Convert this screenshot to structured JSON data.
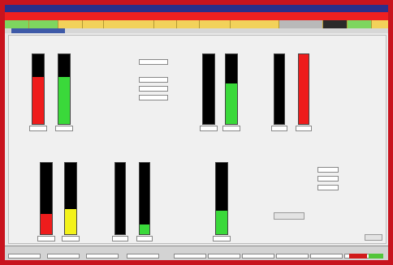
{
  "title": "",
  "alarm_text": "",
  "command_bar": {
    "cells": [
      {
        "label": "",
        "style": "green"
      },
      {
        "label": "",
        "style": "green"
      },
      {
        "label": "",
        "style": ""
      },
      {
        "label": "",
        "style": ""
      },
      {
        "label": "",
        "style": ""
      },
      {
        "label": "",
        "style": ""
      },
      {
        "label": "",
        "style": ""
      },
      {
        "label": "",
        "style": ""
      },
      {
        "label": "",
        "style": ""
      },
      {
        "label": "",
        "style": "gray"
      },
      {
        "label": "",
        "style": "dark"
      },
      {
        "label": "",
        "style": "green"
      }
    ]
  },
  "tab": {
    "label": ""
  },
  "colors": {
    "frame": "#c8141e",
    "alarm": "#ef2020",
    "command": "#f2d25a",
    "fill_red": "#ee1c1c",
    "fill_green": "#3ad93a",
    "fill_yellow": "#f3f21a",
    "bar": "#000000"
  },
  "gauges": {
    "top_left": [
      {
        "name": "",
        "level": 0.67,
        "color": "red",
        "value": ""
      },
      {
        "name": "",
        "level": 0.67,
        "color": "green",
        "value": ""
      }
    ],
    "top_mid": [
      {
        "name": "",
        "level": 0.0,
        "color": "green",
        "value": ""
      },
      {
        "name": "",
        "level": 0.58,
        "color": "green",
        "value": ""
      }
    ],
    "top_right": [
      {
        "name": "",
        "level": 0.0,
        "color": "green",
        "value": ""
      },
      {
        "name": "",
        "level": 1.0,
        "color": "red",
        "value": ""
      }
    ],
    "bot_1": [
      {
        "name": "",
        "level": 0.28,
        "color": "red",
        "value": ""
      },
      {
        "name": "",
        "level": 0.35,
        "color": "yellow",
        "value": ""
      }
    ],
    "bot_2": [
      {
        "name": "",
        "level": 0.0,
        "color": "green",
        "value": ""
      },
      {
        "name": "",
        "level": 0.14,
        "color": "green",
        "value": ""
      }
    ],
    "bot_3": [
      {
        "name": "",
        "level": 0.33,
        "color": "green",
        "value": ""
      }
    ]
  },
  "axis": {
    "top_left": {
      "max": "",
      "mid": "",
      "min": ""
    },
    "top_mid": {
      "max": "",
      "mid": "",
      "min": ""
    },
    "top_right": {
      "max": "",
      "mid": "",
      "min": ""
    },
    "bot": {
      "max": "",
      "mid": "",
      "min": ""
    }
  },
  "fields_top": [
    {
      "label": "",
      "value": "",
      "boxed": true
    },
    {
      "label": "",
      "value": "",
      "boxed": false
    },
    {
      "label": "",
      "value": "",
      "boxed": true
    },
    {
      "label": "",
      "value": "",
      "boxed": true
    },
    {
      "label": "",
      "value": "",
      "boxed": true
    },
    {
      "label": "",
      "value": "",
      "boxed": false
    },
    {
      "label": "",
      "value": "",
      "boxed": false
    }
  ],
  "fields_right": [
    {
      "label": "",
      "value": "",
      "boxed": false
    },
    {
      "label": "",
      "value": "",
      "boxed": true
    },
    {
      "label": "",
      "value": "",
      "boxed": true
    },
    {
      "label": "",
      "value": "",
      "boxed": true
    }
  ],
  "status_bar": {
    "items": [
      "",
      "",
      "",
      "",
      "",
      "",
      "",
      "",
      "",
      ""
    ]
  }
}
